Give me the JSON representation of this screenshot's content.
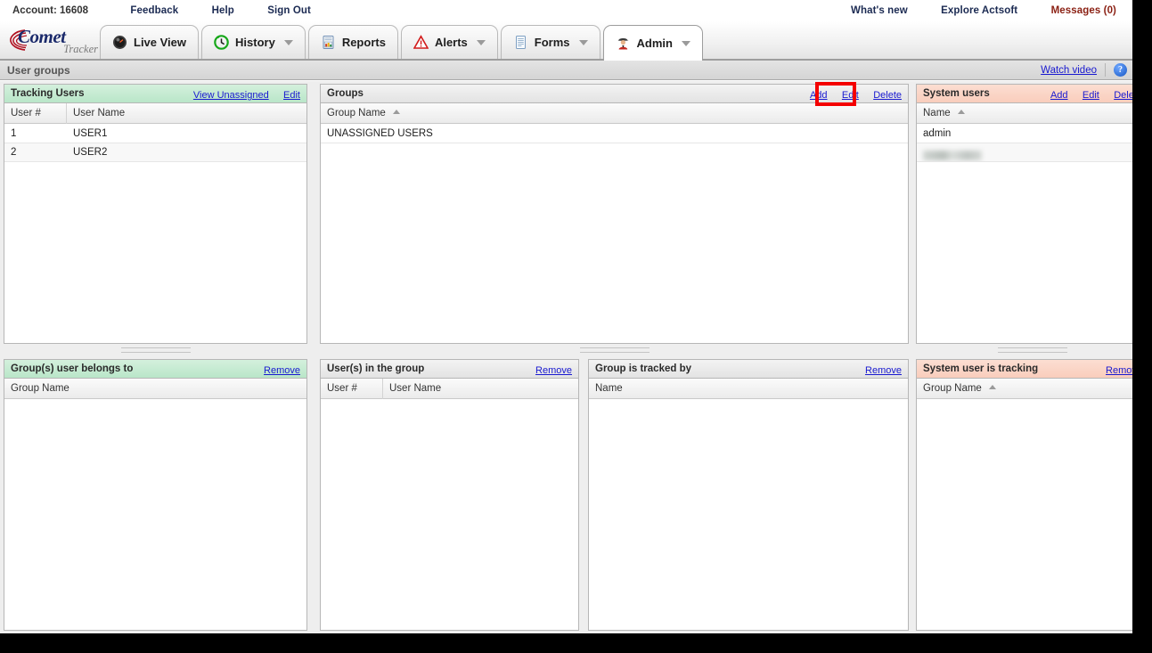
{
  "utility_bar": {
    "account_label": "Account: 16608",
    "left_links": [
      "Feedback",
      "Help",
      "Sign Out"
    ],
    "right_links": [
      "What's new",
      "Explore Actsoft"
    ],
    "messages_label": "Messages (0)"
  },
  "brand": {
    "name": "Comet",
    "sub": "Tracker"
  },
  "tabs": [
    {
      "label": "Live View",
      "icon": "gauge-icon",
      "caret": false,
      "active": false
    },
    {
      "label": "History",
      "icon": "clock-icon",
      "caret": true,
      "active": false
    },
    {
      "label": "Reports",
      "icon": "report-icon",
      "caret": false,
      "active": false
    },
    {
      "label": "Alerts",
      "icon": "warning-icon",
      "caret": true,
      "active": false
    },
    {
      "label": "Forms",
      "icon": "document-icon",
      "caret": true,
      "active": false
    },
    {
      "label": "Admin",
      "icon": "admin-user-icon",
      "caret": true,
      "active": true
    }
  ],
  "subheader": {
    "title": "User groups",
    "watch_video": "Watch video",
    "help_glyph": "?"
  },
  "panels": {
    "tracking_users": {
      "title": "Tracking Users",
      "actions": [
        "View Unassigned",
        "Edit"
      ],
      "columns": [
        "User #",
        "User Name"
      ],
      "rows": [
        {
          "num": "1",
          "name": "USER1"
        },
        {
          "num": "2",
          "name": "USER2"
        }
      ]
    },
    "groups": {
      "title": "Groups",
      "actions": [
        "Add",
        "Edit",
        "Delete"
      ],
      "columns": [
        "Group Name"
      ],
      "sorted_column": "Group Name",
      "sort_direction": "asc",
      "rows": [
        {
          "name": "UNASSIGNED USERS"
        }
      ]
    },
    "system_users": {
      "title": "System users",
      "actions": [
        "Add",
        "Edit",
        "Delete"
      ],
      "columns": [
        "Name"
      ],
      "sorted_column": "Name",
      "sort_direction": "asc",
      "rows": [
        {
          "name": "admin",
          "redacted": false
        },
        {
          "name": "",
          "redacted": true
        }
      ]
    },
    "groups_user_belongs_to": {
      "title": "Group(s) user belongs to",
      "actions": [
        "Remove"
      ],
      "columns": [
        "Group Name"
      ],
      "rows": []
    },
    "users_in_group": {
      "title": "User(s) in the group",
      "actions": [
        "Remove"
      ],
      "columns": [
        "User #",
        "User Name"
      ],
      "rows": []
    },
    "group_tracked_by": {
      "title": "Group is tracked by",
      "actions": [
        "Remove"
      ],
      "columns": [
        "Name"
      ],
      "rows": []
    },
    "system_user_tracking": {
      "title": "System user is tracking",
      "actions": [
        "Remove"
      ],
      "columns": [
        "Group Name"
      ],
      "sorted_column": "Group Name",
      "sort_direction": "asc",
      "rows": []
    }
  },
  "annotation": {
    "target": "Add",
    "color": "#f40000"
  }
}
